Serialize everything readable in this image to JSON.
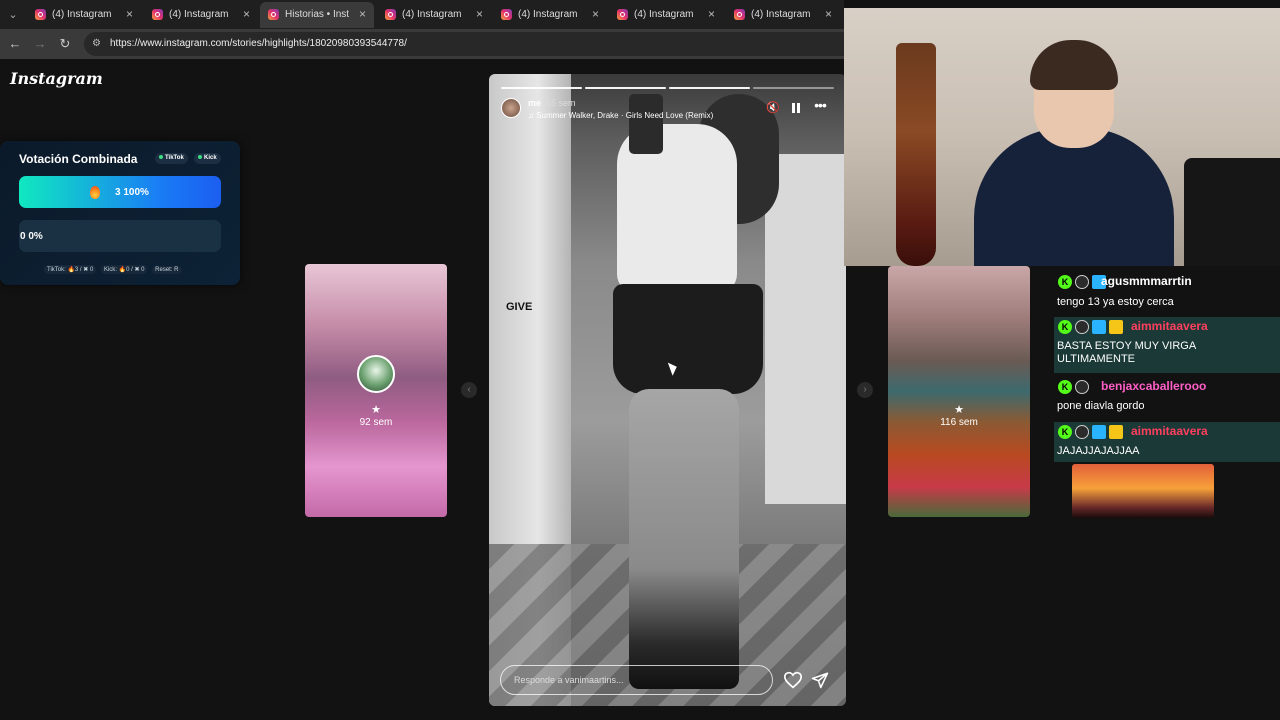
{
  "browser": {
    "tabs": [
      {
        "label": "(4) Instagram",
        "active": false
      },
      {
        "label": "(4) Instagram",
        "active": false
      },
      {
        "label": "Historias • Instagram",
        "active": true
      },
      {
        "label": "(4) Instagram",
        "active": false
      },
      {
        "label": "(4) Instagram",
        "active": false
      },
      {
        "label": "(4) Instagram",
        "active": false
      },
      {
        "label": "(4) Instagram",
        "active": false
      }
    ],
    "tab_close": "×",
    "menu_glyph": "⌄",
    "back_glyph": "←",
    "forward_glyph": "→",
    "reload_glyph": "↻",
    "site_info_glyph": "⚙",
    "url": "https://www.instagram.com/stories/highlights/18020980393544778/"
  },
  "page": {
    "logo": "Instagram"
  },
  "vote": {
    "title": "Votación Combinada",
    "pill_tiktok": "TikTok",
    "pill_kick": "Kick",
    "bar1_text": "3   100%",
    "bar1_fraction": 1.0,
    "bar2_text": "0   0%",
    "bar2_fraction": 0.0,
    "footer_tiktok": "TikTok: 🔥3 / ✖ 0",
    "footer_kick": "Kick: 🔥0 / ✖ 0",
    "footer_reset": "Reset: R"
  },
  "stories": {
    "left": {
      "star": "★",
      "ago": "92 sem"
    },
    "right": {
      "star": "★",
      "ago": "116 sem"
    },
    "prev_glyph": "‹",
    "next_glyph": "›",
    "main": {
      "username": "me",
      "time": "55 sem",
      "song": "♫ Summer Walker, Drake · Girls Need Love (Remix)",
      "mute_glyph": "🔇",
      "more_glyph": "•••",
      "overlay_text": "GIVE",
      "reply_placeholder": "Responde a vanimaartins...",
      "progress_segments": 4,
      "progress_done": 3
    }
  },
  "chat": {
    "messages": [
      {
        "name": "agusmmmarrtin",
        "name_color": "#ffffff",
        "text": "tengo 13 ya estoy cerca",
        "highlight": false
      },
      {
        "name": "aimmitaavera",
        "name_color": "#ff3f5e",
        "text": "BASTA ESTOY MUY VIRGA ULTIMAMENTE",
        "highlight": true
      },
      {
        "name": "benjaxcaballerooo",
        "name_color": "#ff5ec7",
        "text": "pone diavla gordo",
        "highlight": false
      },
      {
        "name": "aimmitaavera",
        "name_color": "#ff3f5e",
        "text": "JAJAJJAJAJJAA",
        "highlight": true
      }
    ]
  },
  "colors": {
    "ig_gradient_a": "#f9a23c",
    "ig_gradient_b": "#e1306c",
    "kick_green": "#53fc18",
    "vote_bar_start": "#10e8c0",
    "vote_bar_end": "#1b5ef0"
  }
}
